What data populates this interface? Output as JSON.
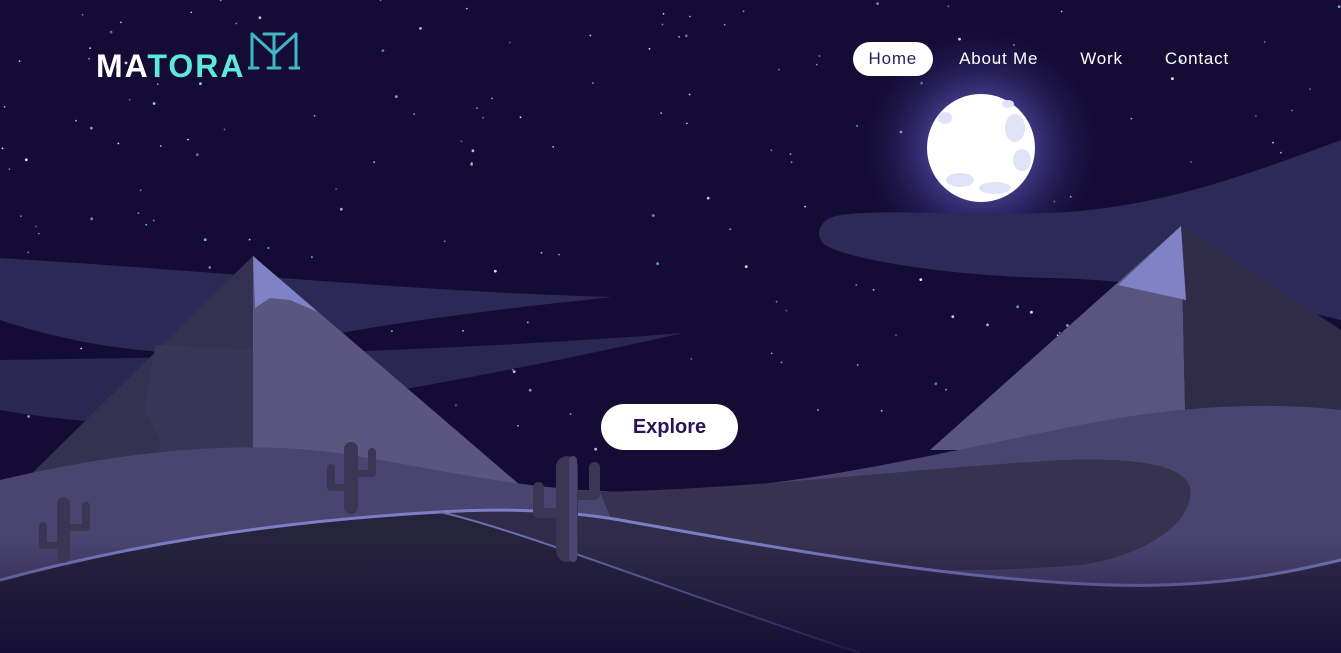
{
  "brand": {
    "name_part1": "MA",
    "name_part2": "TORA",
    "accent_color": "#5ee8dc"
  },
  "nav": {
    "items": [
      {
        "label": "Home",
        "active": true
      },
      {
        "label": "About Me",
        "active": false
      },
      {
        "label": "Work",
        "active": false
      },
      {
        "label": "Contact",
        "active": false
      }
    ]
  },
  "hero": {
    "cta_label": "Explore"
  },
  "colors": {
    "sky": "#140c34",
    "moon": "#ffffff",
    "moon_glow": "#8a7ff0",
    "dune_light": "#4a4570",
    "dune_dark": "#26233d",
    "pyramid_lit": "#5a5680",
    "pyramid_shade": "#302c48",
    "pyramid_tip": "#7f82c4"
  }
}
